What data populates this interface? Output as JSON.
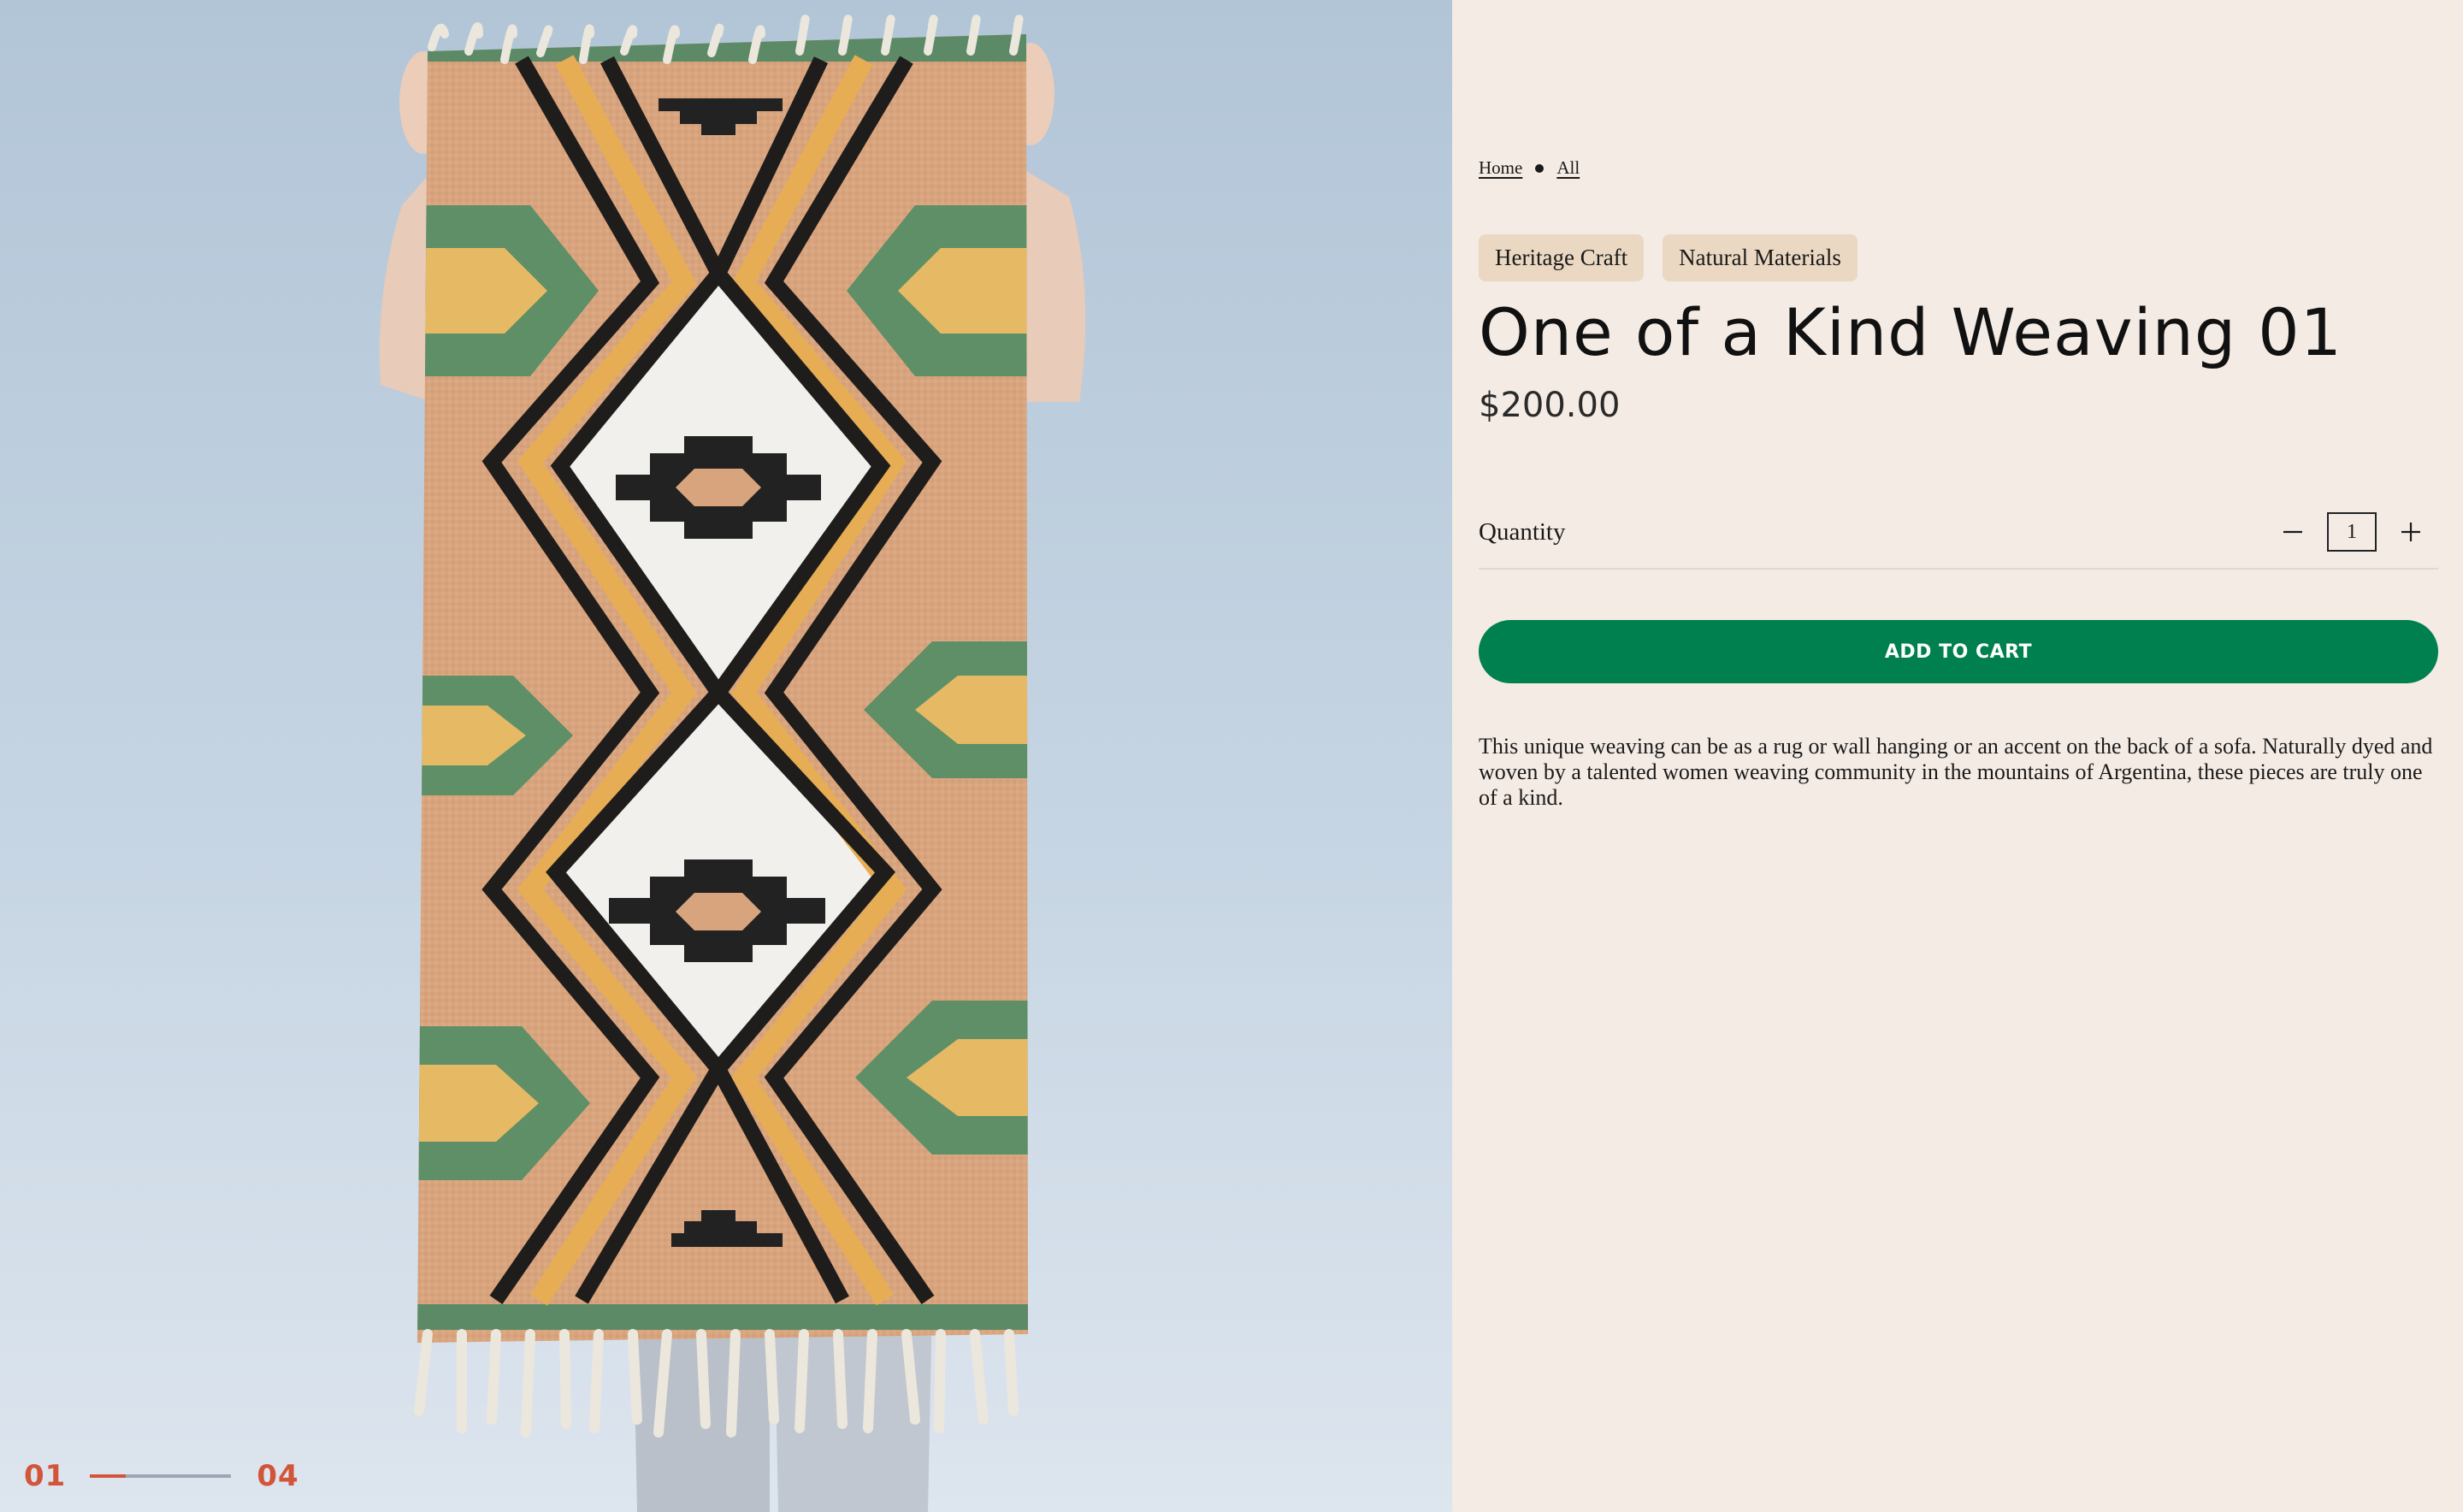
{
  "gallery": {
    "current_slide": "01",
    "total_slides": "04",
    "progress": 0.25,
    "image_alt": "Woven rug with geometric diamond and zigzag pattern held up against a light blue backdrop",
    "colors": {
      "accent": "#d2553a"
    }
  },
  "breadcrumb": {
    "home": "Home",
    "all": "All"
  },
  "tags": [
    "Heritage Craft",
    "Natural Materials"
  ],
  "product": {
    "title": "One of a Kind Weaving 01",
    "price": "$200.00",
    "quantity_label": "Quantity",
    "quantity_value": "1",
    "add_to_cart_label": "ADD TO CART",
    "description": "This unique weaving can be as a rug or wall hanging or an accent on the back of a sofa. Naturally dyed and woven by a talented women weaving community in the mountains of Argentina, these pieces are truly one of a kind."
  },
  "colors": {
    "cta": "#00804f",
    "tag_bg": "#ead8c2",
    "panel_bg": "#f4ebe4"
  },
  "icons": {
    "decrease": "minus-icon",
    "increase": "plus-icon"
  }
}
